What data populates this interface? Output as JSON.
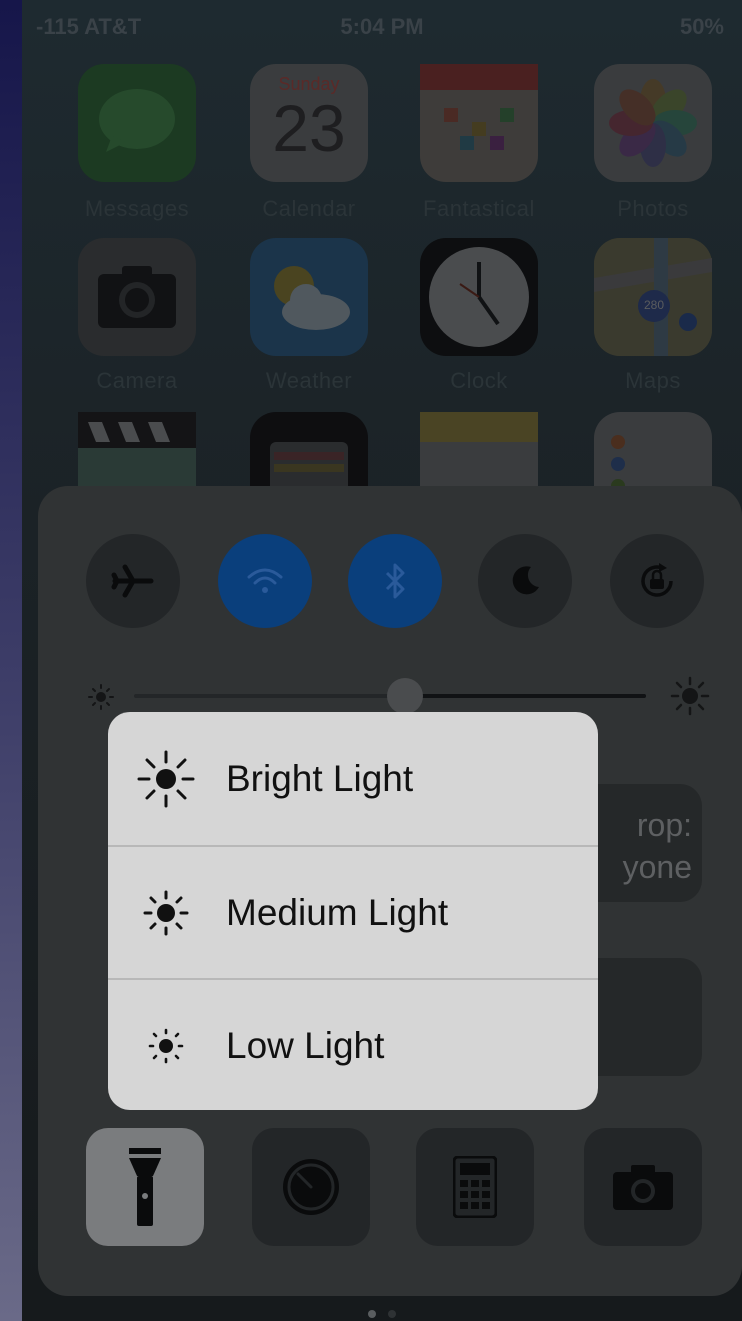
{
  "status_bar": {
    "carrier": "-115 AT&T",
    "time": "5:04 PM",
    "battery": "50%"
  },
  "home_screen": {
    "apps": [
      {
        "id": "messages",
        "label": "Messages",
        "icon": "messages-icon"
      },
      {
        "id": "calendar",
        "label": "Calendar",
        "icon": "calendar-icon",
        "day": "Sunday",
        "date": "23"
      },
      {
        "id": "fantastical",
        "label": "Fantastical",
        "icon": "fantastical-icon"
      },
      {
        "id": "photos",
        "label": "Photos",
        "icon": "photos-icon"
      },
      {
        "id": "camera",
        "label": "Camera",
        "icon": "camera-icon"
      },
      {
        "id": "weather",
        "label": "Weather",
        "icon": "weather-icon"
      },
      {
        "id": "clock",
        "label": "Clock",
        "icon": "clock-icon"
      },
      {
        "id": "maps",
        "label": "Maps",
        "icon": "maps-icon",
        "badge": "280"
      },
      {
        "id": "clips",
        "icon": "clips-icon"
      },
      {
        "id": "wallet",
        "icon": "wallet-icon"
      },
      {
        "id": "notes",
        "icon": "notes-icon"
      },
      {
        "id": "reminders",
        "icon": "reminders-icon"
      }
    ]
  },
  "control_center": {
    "toggles": [
      {
        "id": "airplane",
        "icon": "airplane-icon",
        "on": false
      },
      {
        "id": "wifi",
        "icon": "wifi-icon",
        "on": true
      },
      {
        "id": "bluetooth",
        "icon": "bluetooth-icon",
        "on": true
      },
      {
        "id": "do-not-disturb",
        "icon": "moon-icon",
        "on": false
      },
      {
        "id": "rotation-lock",
        "icon": "rotation-lock-icon",
        "on": false
      }
    ],
    "brightness": {
      "level": 0.53
    },
    "airdrop": {
      "text_line1": "rop:",
      "text_line2": "yone"
    },
    "buttons": [
      {
        "id": "flashlight",
        "icon": "flashlight-icon",
        "active": true
      },
      {
        "id": "timer",
        "icon": "timer-icon"
      },
      {
        "id": "calculator",
        "icon": "calculator-icon"
      },
      {
        "id": "camera",
        "icon": "camera-icon"
      }
    ],
    "page_dots": {
      "count": 2,
      "active": 0
    }
  },
  "flashlight_menu": {
    "items": [
      {
        "label": "Bright Light",
        "icon": "sun-large-icon"
      },
      {
        "label": "Medium Light",
        "icon": "sun-medium-icon"
      },
      {
        "label": "Low Light",
        "icon": "sun-small-icon"
      }
    ]
  },
  "colors": {
    "popup_bg": "#d6d6d6",
    "toggle_on": "#0a3f7c",
    "flashlight_active": "#7a7c7e"
  }
}
